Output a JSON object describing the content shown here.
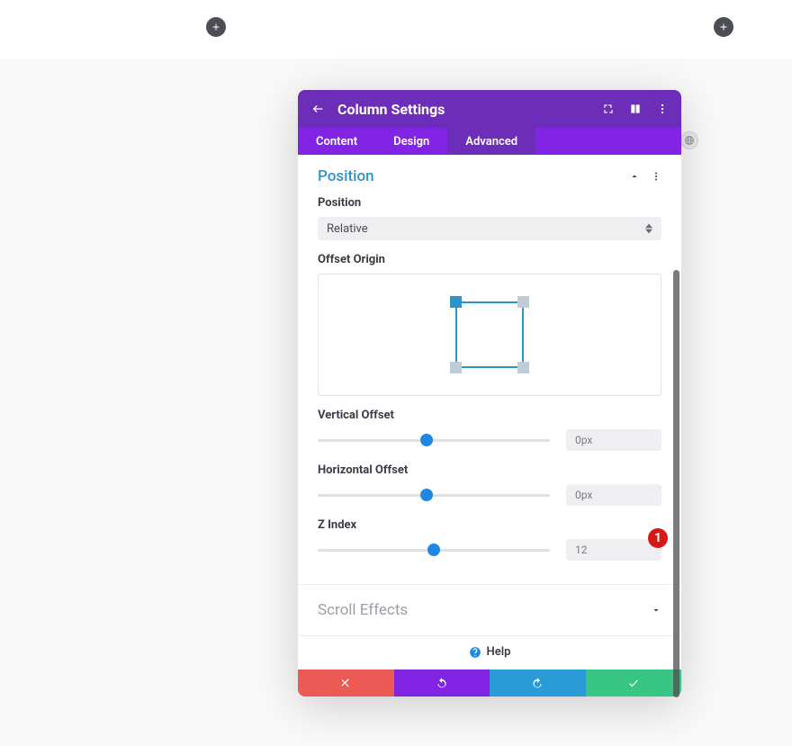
{
  "top_add_buttons": {
    "left": "add",
    "right": "add"
  },
  "panel": {
    "title": "Column Settings",
    "tabs": [
      {
        "label": "Content",
        "active": false
      },
      {
        "label": "Design",
        "active": false
      },
      {
        "label": "Advanced",
        "active": true
      }
    ],
    "sections": {
      "position": {
        "title": "Position",
        "fields": {
          "position_label": "Position",
          "position_value": "Relative",
          "offset_origin_label": "Offset Origin",
          "offset_origin_selected": "top-left",
          "vertical_offset_label": "Vertical Offset",
          "vertical_offset_value": "0px",
          "horizontal_offset_label": "Horizontal Offset",
          "horizontal_offset_value": "0px",
          "z_index_label": "Z Index",
          "z_index_value": "12"
        }
      },
      "scroll_effects": {
        "title": "Scroll Effects"
      }
    },
    "help_label": "Help",
    "footer_buttons": [
      "cancel",
      "undo",
      "redo",
      "save"
    ]
  },
  "annotation": {
    "badge": "1"
  }
}
